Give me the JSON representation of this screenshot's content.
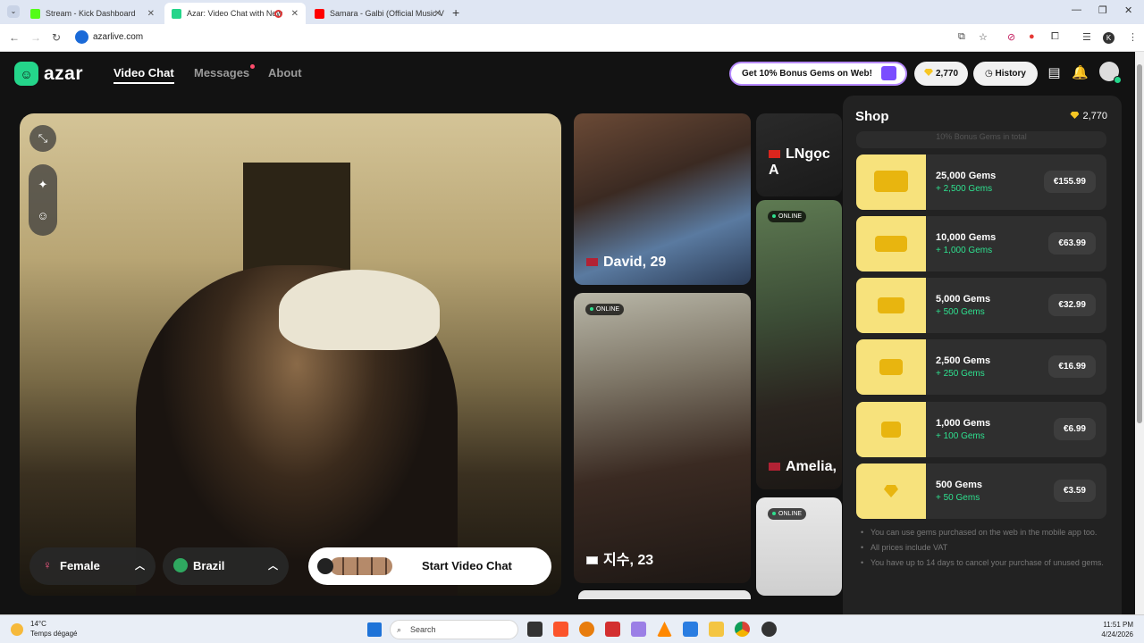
{
  "browser": {
    "tabs": [
      {
        "title": "Stream - Kick Dashboard",
        "favicon_color": "#53fc18",
        "active": false
      },
      {
        "title": "Azar: Video Chat with New",
        "favicon_color": "#24d58a",
        "active": true
      },
      {
        "title": "Samara - Galbi (Official Music V",
        "favicon_color": "#ff0000",
        "active": false
      }
    ],
    "new_tab": "+",
    "url": "azarlive.com",
    "profile_initial": "K"
  },
  "header": {
    "logo": "azar",
    "nav": [
      {
        "label": "Video Chat",
        "active": true
      },
      {
        "label": "Messages",
        "active": false
      },
      {
        "label": "About",
        "active": false
      }
    ],
    "bonus_banner": "Get 10% Bonus Gems on Web!",
    "gems": "2,770",
    "history_label": "History"
  },
  "video": {
    "gender_filter": "Female",
    "region_filter": "Brazil",
    "start_label": "Start Video Chat"
  },
  "cards": [
    {
      "name": "David, 29",
      "flag": "us",
      "online": false
    },
    {
      "name": "LNgọc A",
      "flag": "vn",
      "online": false
    },
    {
      "name": "지수, 23",
      "flag": "kr",
      "online": true
    },
    {
      "name": "Amelia,",
      "flag": "us",
      "online": true
    },
    {
      "name": "",
      "flag": "",
      "online": true
    }
  ],
  "online_label": "ONLINE",
  "shop": {
    "title": "Shop",
    "balance": "2,770",
    "strip_text": "10% Bonus Gems in total",
    "packs": [
      {
        "gems": "25,000 Gems",
        "bonus": "+ 2,500 Gems",
        "price": "€155.99"
      },
      {
        "gems": "10,000 Gems",
        "bonus": "+ 1,000 Gems",
        "price": "€63.99"
      },
      {
        "gems": "5,000 Gems",
        "bonus": "+ 500 Gems",
        "price": "€32.99"
      },
      {
        "gems": "2,500 Gems",
        "bonus": "+ 250 Gems",
        "price": "€16.99"
      },
      {
        "gems": "1,000 Gems",
        "bonus": "+ 100 Gems",
        "price": "€6.99"
      },
      {
        "gems": "500 Gems",
        "bonus": "+ 50 Gems",
        "price": "€3.59"
      }
    ],
    "notes": [
      "You can use gems purchased on the web in the mobile app too.",
      "All prices include VAT",
      "You have up to 14 days to cancel your purchase of unused gems."
    ]
  },
  "taskbar": {
    "temp": "14°C",
    "weather": "Temps dégagé",
    "search": "Search",
    "time": "11:51 PM",
    "date": "4/24/2026"
  }
}
